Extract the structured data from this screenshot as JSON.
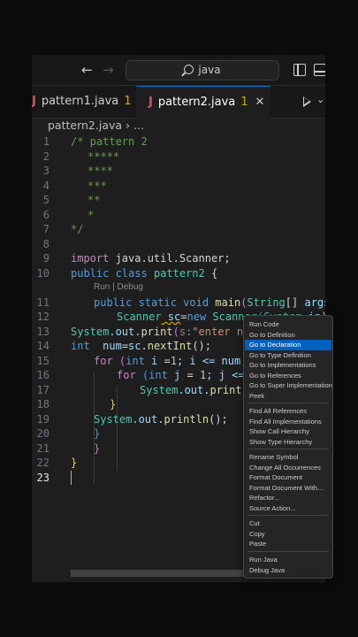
{
  "titlebar": {
    "search_text": "java",
    "back_icon": "arrow-left-icon",
    "forward_icon": "arrow-right-icon"
  },
  "tabs": [
    {
      "icon": "J",
      "label": "pattern1.java",
      "problems": "1"
    },
    {
      "icon": "J",
      "label": "pattern2.java",
      "problems": "1",
      "close": "✕"
    }
  ],
  "breadcrumb": {
    "file": "pattern2.java",
    "sep": "›",
    "more": "..."
  },
  "codelens": "Run | Debug",
  "lines": [
    {
      "n": "1"
    },
    {
      "n": "2"
    },
    {
      "n": "3"
    },
    {
      "n": "4"
    },
    {
      "n": "5"
    },
    {
      "n": "6"
    },
    {
      "n": "7"
    },
    {
      "n": "8"
    },
    {
      "n": "9"
    },
    {
      "n": "10"
    },
    {
      "n": "11"
    },
    {
      "n": "12"
    },
    {
      "n": "13"
    },
    {
      "n": "14"
    },
    {
      "n": "15"
    },
    {
      "n": "16"
    },
    {
      "n": "17"
    },
    {
      "n": "18"
    },
    {
      "n": "19"
    },
    {
      "n": "20"
    },
    {
      "n": "21"
    },
    {
      "n": "22"
    },
    {
      "n": "23"
    }
  ],
  "code": {
    "l1": "/* pattern 2",
    "l2": "*****",
    "l3": "****",
    "l4": "***",
    "l5": "**",
    "l6": "*",
    "l7": "*/",
    "l9a": "import",
    "l9b": " java.util.Scanner;",
    "l10a": "public",
    "l10b": " class ",
    "l10c": "pattern2",
    "l10d": " {",
    "l11a": "public",
    "l11b": " static ",
    "l11c": "void",
    "l11d": " main",
    "l11e": "(",
    "l11f": "String",
    "l11g": "[] ",
    "l11h": "args",
    "l11i": ")",
    "l11j": " {",
    "l12a": "Scanner",
    "l12b": " sc",
    "l12c": "=",
    "l12d": "new",
    "l12e": " Scanner",
    "l12f": "(",
    "l12g": "System",
    "l12h": ".in",
    "l12i": ");",
    "l13a": "System",
    "l13b": ".out.",
    "l13c": "print",
    "l13d": "(",
    "l13e": "s:",
    "l13f": "\"enter numb",
    "l14a": "int",
    "l14b": "  num",
    "l14c": "=",
    "l14d": "sc",
    "l14e": ".",
    "l14f": "nextInt",
    "l14g": "();",
    "l15a": "for",
    "l15b": " (",
    "l15c": "int",
    "l15d": " i ",
    "l15e": "=",
    "l15f": "1",
    "l15g": "; i <= num; i",
    "l16a": "for",
    "l16b": " (",
    "l16c": "int",
    "l16d": " j ",
    "l16e": "= ",
    "l16f": "1",
    "l16g": "; j <=nu",
    "l17a": "System",
    "l17b": ".out.",
    "l17c": "print",
    "l17d": "(s",
    "l18": "}",
    "l19a": "System",
    "l19b": ".out.",
    "l19c": "println",
    "l19d": "();",
    "l20": "}",
    "l21": "}",
    "l22": "}"
  },
  "context_menu": [
    "Run Code",
    "Go to Definition",
    "Go to Declaration",
    "Go to Type Definition",
    "Go to Implementations",
    "Go to References",
    "Go to Super Implementation",
    "Peek",
    "Find All References",
    "Find All Implementations",
    "Show Call Hierarchy",
    "Show Type Hierarchy",
    "Rename Symbol",
    "Change All Occurrences",
    "Format Document",
    "Format Document With...",
    "Refactor...",
    "Source Action...",
    "Cut",
    "Copy",
    "Paste",
    "Run Java",
    "Debug Java"
  ],
  "colors": {
    "accent": "#0078d4",
    "menu_selected": "#0060c0",
    "error_j": "#e0525e",
    "warning_count": "#cca700"
  }
}
